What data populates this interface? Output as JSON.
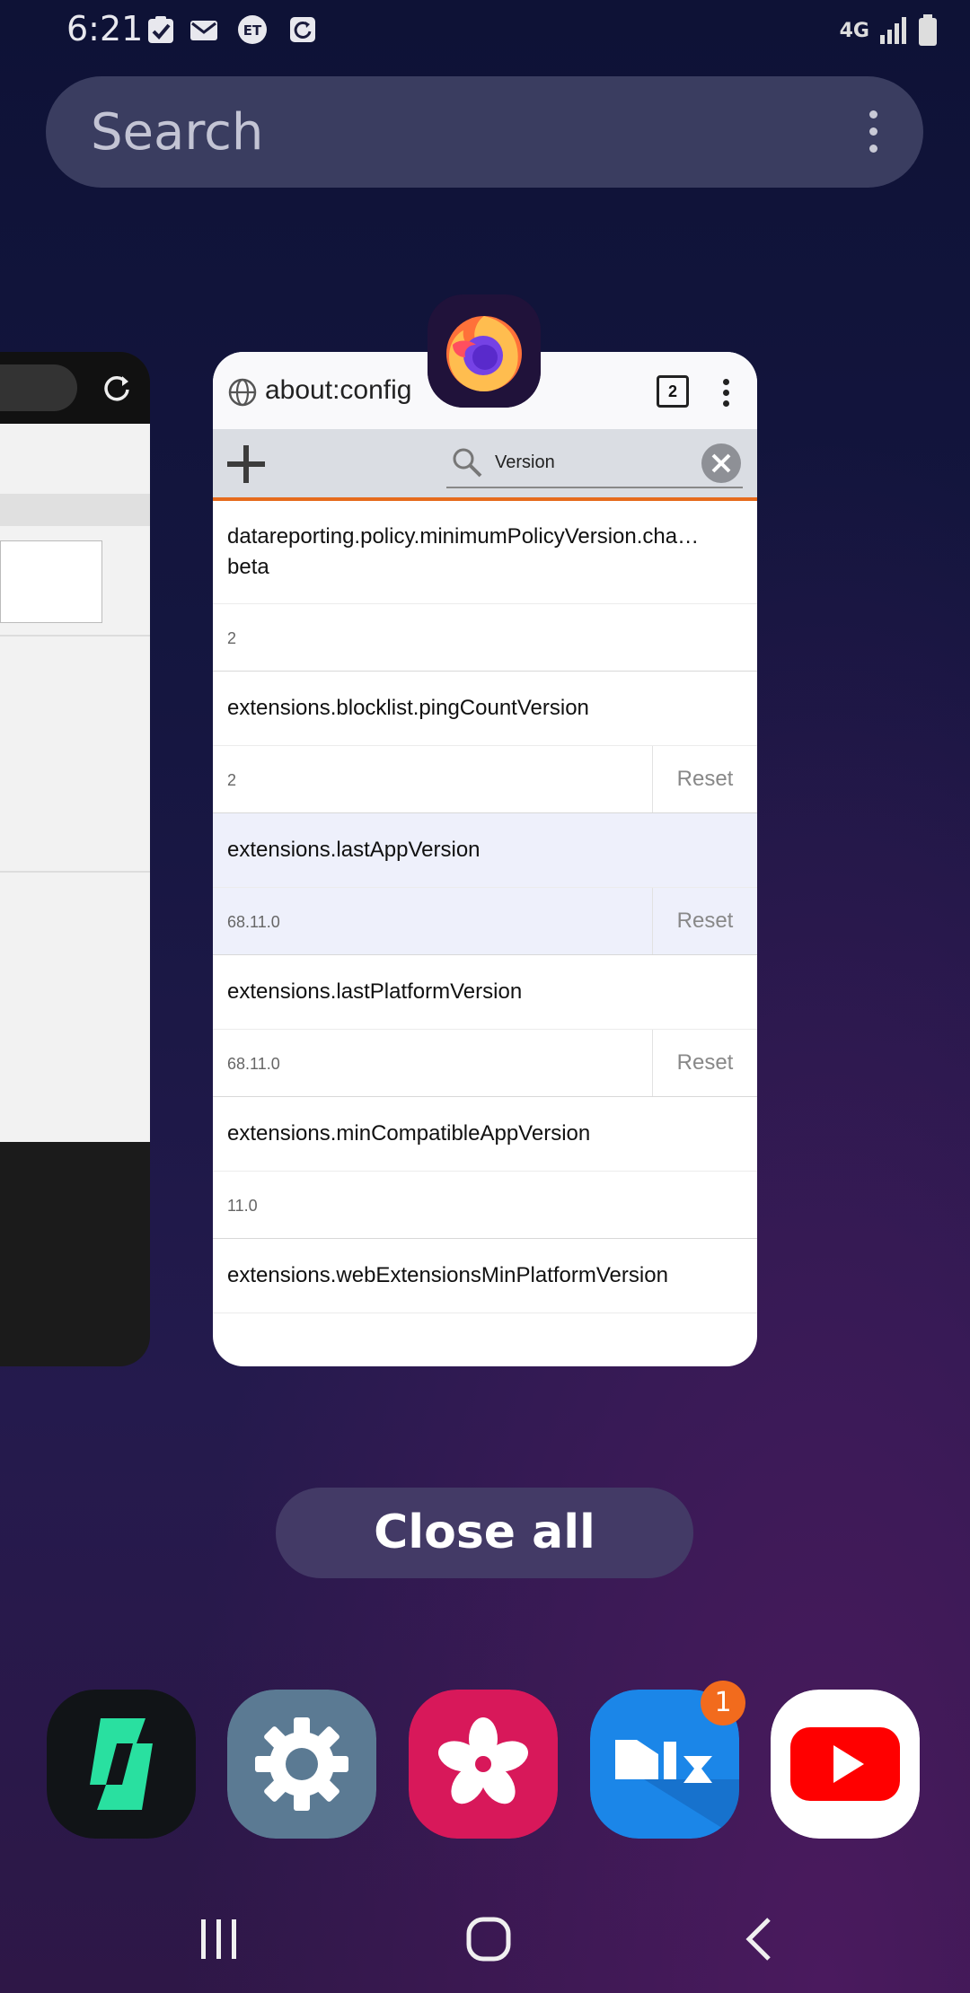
{
  "status_bar": {
    "time": "6:21",
    "notification_icons": [
      "task-check-icon",
      "mail-icon",
      "et-icon",
      "refresh-notification-icon"
    ],
    "network": "4G",
    "icons": [
      "signal-icon",
      "battery-icon"
    ]
  },
  "search": {
    "placeholder": "Search",
    "more_icon": "more-vert-icon"
  },
  "recent_apps": {
    "firefox_card": {
      "app_icon": "firefox-icon",
      "url": "about:config",
      "tab_count": "2",
      "filter_text": "Version",
      "prefs": [
        {
          "name": "datareporting.policy.minimumPolicyVersion.cha… beta",
          "value": "2",
          "reset": ""
        },
        {
          "name": "extensions.blocklist.pingCountVersion",
          "value": "2",
          "reset": "Reset"
        },
        {
          "name": "extensions.lastAppVersion",
          "value": "68.11.0",
          "reset": "Reset"
        },
        {
          "name": "extensions.lastPlatformVersion",
          "value": "68.11.0",
          "reset": "Reset"
        },
        {
          "name": "extensions.minCompatibleAppVersion",
          "value": "11.0",
          "reset": ""
        },
        {
          "name": "extensions.webExtensionsMinPlatformVersion",
          "value": "",
          "reset": ""
        }
      ]
    },
    "close_all_label": "Close all"
  },
  "dock": {
    "apps": [
      "deezer-icon",
      "settings-icon",
      "gallery-icon",
      "mix-icon",
      "youtube-icon"
    ],
    "badge": "1"
  },
  "nav_bar": [
    "recents-icon",
    "home-icon",
    "back-icon"
  ],
  "colors": {
    "accent_orange": "#e66b1d",
    "search_bg": "#3a3d60",
    "close_all_bg": "#433a66"
  }
}
